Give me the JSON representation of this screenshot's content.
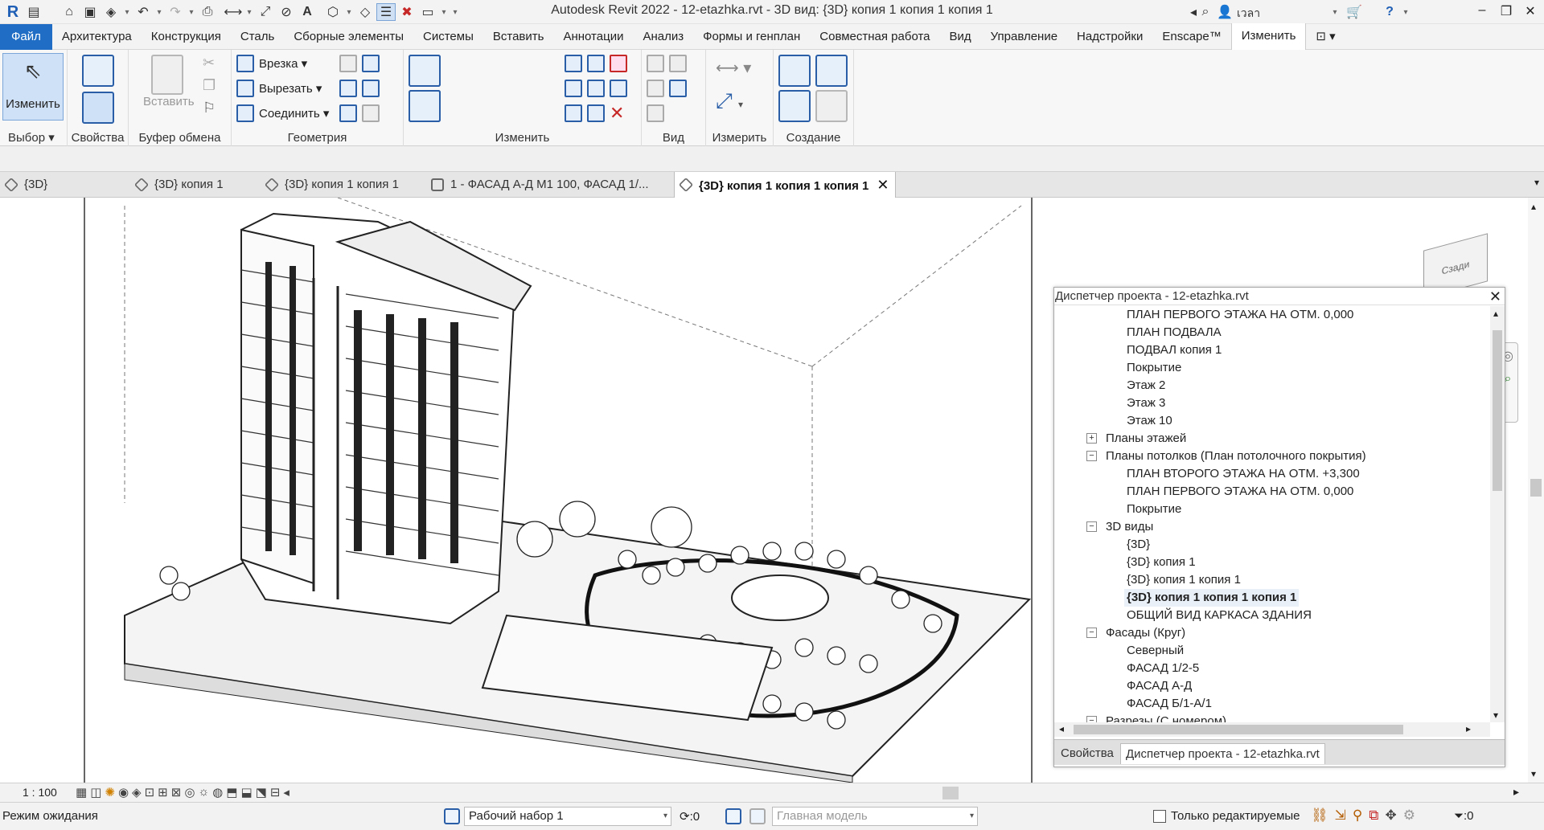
{
  "app": {
    "title": "Autodesk Revit 2022 - 12-etazhka.rvt - 3D вид: {3D} копия 1 копия 1 копия 1",
    "user": "เวลา"
  },
  "menu": {
    "items": [
      "Файл",
      "Архитектура",
      "Конструкция",
      "Сталь",
      "Сборные элементы",
      "Системы",
      "Вставить",
      "Аннотации",
      "Анализ",
      "Формы и генплан",
      "Совместная работа",
      "Вид",
      "Управление",
      "Надстройки",
      "Enscape™",
      "Изменить"
    ]
  },
  "ribbon": {
    "select": {
      "button": "Изменить",
      "label": "Выбор"
    },
    "properties": {
      "label": "Свойства"
    },
    "clipboard": {
      "paste": "Вставить",
      "label": "Буфер обмена"
    },
    "geometry": {
      "cope": "Врезка",
      "cut": "Вырезать",
      "join": "Соединить",
      "label": "Геометрия"
    },
    "modify": {
      "label": "Изменить"
    },
    "view": {
      "label": "Вид"
    },
    "measure": {
      "label": "Измерить"
    },
    "create": {
      "label": "Создание"
    }
  },
  "tabs": [
    {
      "label": "{3D}"
    },
    {
      "label": "{3D} копия 1"
    },
    {
      "label": "{3D} копия 1 копия 1"
    },
    {
      "label": "1 - ФАСАД А-Д М1 100, ФАСАД 1/..."
    },
    {
      "label": "{3D} копия 1 копия 1 копия 1",
      "active": true
    }
  ],
  "browser": {
    "title": "Диспетчер проекта - 12-etazhka.rvt",
    "tree": [
      {
        "label": "ПЛАН ПЕРВОГО ЭТАЖА НА ОТМ. 0,000",
        "level": 2
      },
      {
        "label": "ПЛАН ПОДВАЛА",
        "level": 2
      },
      {
        "label": "ПОДВАЛ копия 1",
        "level": 2
      },
      {
        "label": "Покрытие",
        "level": 2
      },
      {
        "label": "Этаж 2",
        "level": 2
      },
      {
        "label": "Этаж 3",
        "level": 2
      },
      {
        "label": "Этаж 10",
        "level": 2
      },
      {
        "label": "Планы этажей",
        "level": 1,
        "toggle": "+"
      },
      {
        "label": "Планы потолков (План потолочного покрытия)",
        "level": 1,
        "toggle": "−"
      },
      {
        "label": "ПЛАН ВТОРОГО ЭТАЖА НА ОТМ. +3,300",
        "level": 2
      },
      {
        "label": "ПЛАН ПЕРВОГО ЭТАЖА НА ОТМ. 0,000",
        "level": 2
      },
      {
        "label": "Покрытие",
        "level": 2
      },
      {
        "label": "3D виды",
        "level": 1,
        "toggle": "−"
      },
      {
        "label": "{3D}",
        "level": 2
      },
      {
        "label": "{3D} копия 1",
        "level": 2
      },
      {
        "label": "{3D} копия 1 копия 1",
        "level": 2
      },
      {
        "label": "{3D} копия 1 копия 1 копия 1",
        "level": 2,
        "selected": true
      },
      {
        "label": "ОБЩИЙ ВИД КАРКАСА ЗДАНИЯ",
        "level": 2
      },
      {
        "label": "Фасады (Круг)",
        "level": 1,
        "toggle": "−"
      },
      {
        "label": "Северный",
        "level": 2
      },
      {
        "label": "ФАСАД 1/2-5",
        "level": 2
      },
      {
        "label": "ФАСАД А-Д",
        "level": 2
      },
      {
        "label": "ФАСАД Б/1-А/1",
        "level": 2
      },
      {
        "label": "Разрезы (С номером)",
        "level": 1,
        "toggle": "−"
      }
    ],
    "bottom_tabs": [
      "Свойства",
      "Диспетчер проекта - 12-etazhka.rvt"
    ]
  },
  "viewcube": {
    "label": "Сзади"
  },
  "viewbar": {
    "scale": "1 : 100"
  },
  "status": {
    "message": "Режим ожидания",
    "workset": "Рабочий набор 1",
    "workset_count": ":0",
    "design_option": "Главная модель",
    "editable_only": "Только редактируемые",
    "filter_count": ":0"
  }
}
